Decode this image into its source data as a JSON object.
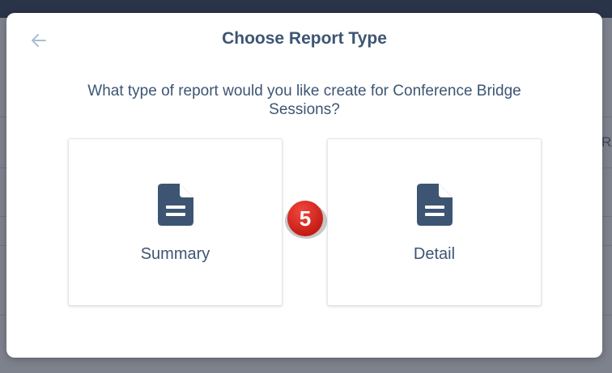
{
  "background": {
    "edge_text": "RA"
  },
  "modal": {
    "title": "Choose Report Type",
    "back_icon": "arrow-left-icon",
    "question": "What type of report would you like create for Conference Bridge Sessions?",
    "options": [
      {
        "label": "Summary",
        "icon": "document-icon"
      },
      {
        "label": "Detail",
        "icon": "document-icon"
      }
    ]
  },
  "annotation": {
    "step_number": "5",
    "color": "#d8221a"
  },
  "colors": {
    "title": "#3d5573",
    "icon": "#3d5573",
    "back_arrow": "#a9bfd3",
    "top_bar": "#2a3448"
  }
}
